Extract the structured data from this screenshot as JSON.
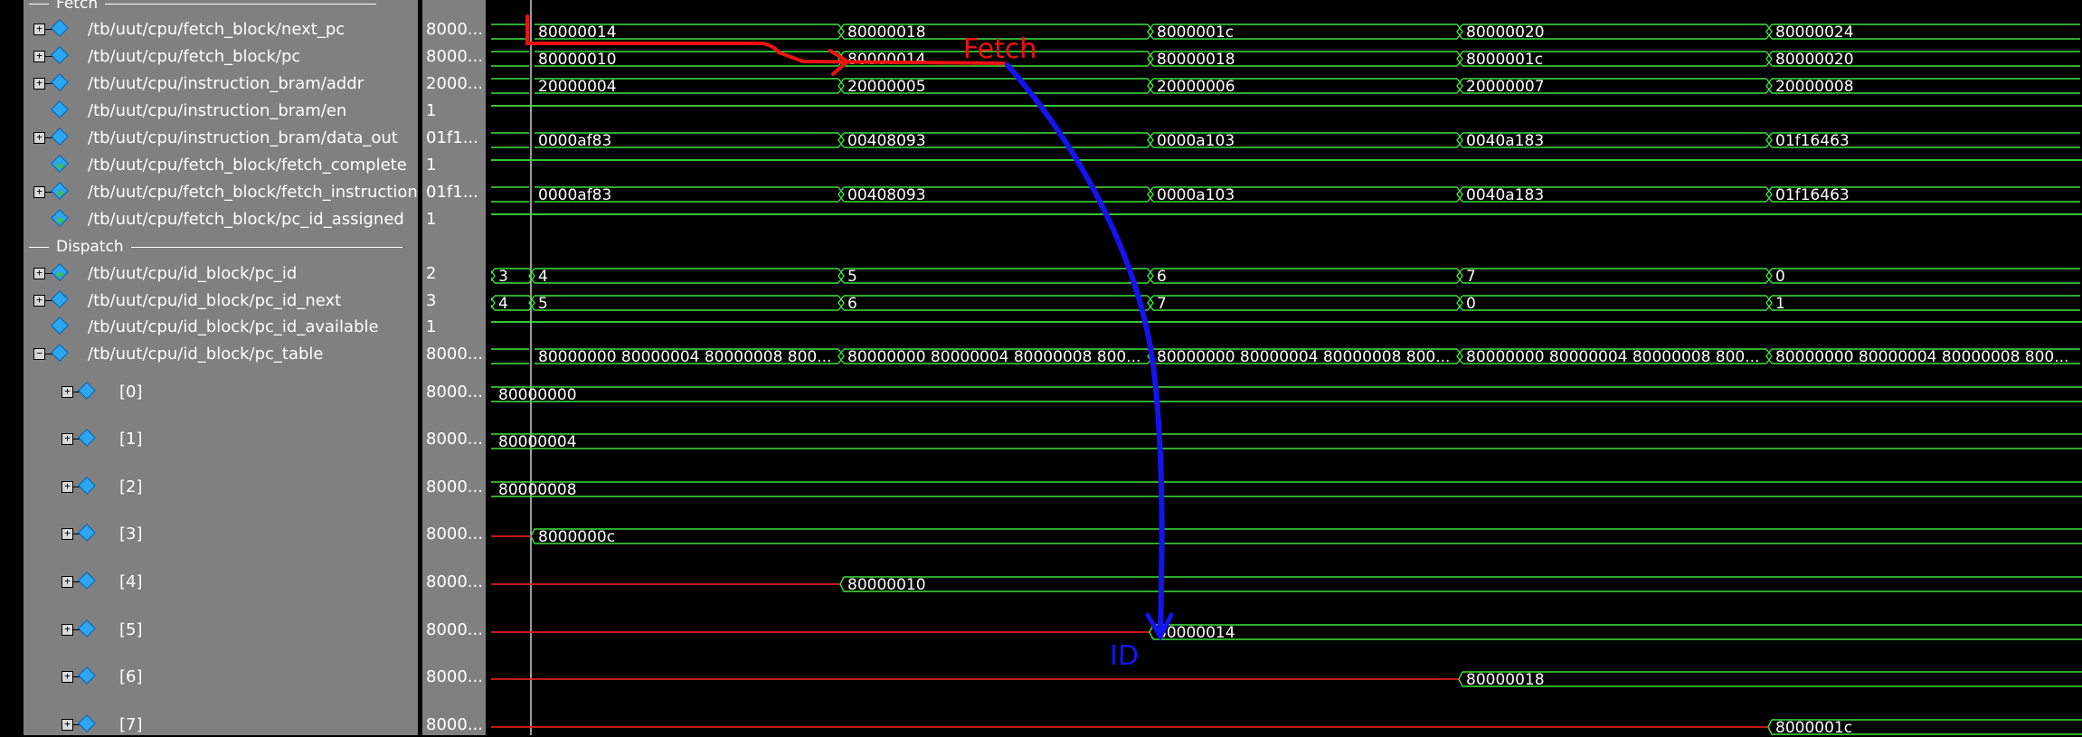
{
  "groups": {
    "fetch": "Fetch",
    "dispatch": "Dispatch"
  },
  "signals": [
    {
      "name": "/tb/uut/cpu/fetch_block/next_pc",
      "value": "8000...",
      "expand": "+",
      "icon": "signal-icon"
    },
    {
      "name": "/tb/uut/cpu/fetch_block/pc",
      "value": "8000...",
      "expand": "+",
      "icon": "signal-icon"
    },
    {
      "name": "/tb/uut/cpu/instruction_bram/addr",
      "value": "2000...",
      "expand": "+",
      "icon": "signal-icon"
    },
    {
      "name": "/tb/uut/cpu/instruction_bram/en",
      "value": "1",
      "expand": "",
      "icon": "signal-icon"
    },
    {
      "name": "/tb/uut/cpu/instruction_bram/data_out",
      "value": "01f1...",
      "expand": "+",
      "icon": "signal-icon"
    },
    {
      "name": "/tb/uut/cpu/fetch_block/fetch_complete",
      "value": "1",
      "expand": "",
      "icon": "signal-continuous-icon"
    },
    {
      "name": "/tb/uut/cpu/fetch_block/fetch_instruction",
      "value": "01f1...",
      "expand": "+",
      "icon": "signal-continuous-icon"
    },
    {
      "name": "/tb/uut/cpu/fetch_block/pc_id_assigned",
      "value": "1",
      "expand": "",
      "icon": "signal-continuous-icon"
    },
    {
      "name": "/tb/uut/cpu/id_block/pc_id",
      "value": "2",
      "expand": "+",
      "icon": "signal-continuous-icon"
    },
    {
      "name": "/tb/uut/cpu/id_block/pc_id_next",
      "value": "3",
      "expand": "+",
      "icon": "signal-icon"
    },
    {
      "name": "/tb/uut/cpu/id_block/pc_id_available",
      "value": "1",
      "expand": "",
      "icon": "signal-icon"
    },
    {
      "name": "/tb/uut/cpu/id_block/pc_table",
      "value": "8000...",
      "expand": "−",
      "icon": "signal-icon"
    },
    {
      "name": "[0]",
      "value": "8000...",
      "expand": "+",
      "icon": "signal-icon"
    },
    {
      "name": "[1]",
      "value": "8000...",
      "expand": "+",
      "icon": "signal-icon"
    },
    {
      "name": "[2]",
      "value": "8000...",
      "expand": "+",
      "icon": "signal-icon"
    },
    {
      "name": "[3]",
      "value": "8000...",
      "expand": "+",
      "icon": "signal-icon"
    },
    {
      "name": "[4]",
      "value": "8000...",
      "expand": "+",
      "icon": "signal-icon"
    },
    {
      "name": "[5]",
      "value": "8000...",
      "expand": "+",
      "icon": "signal-icon"
    },
    {
      "name": "[6]",
      "value": "8000...",
      "expand": "+",
      "icon": "signal-icon"
    },
    {
      "name": "[7]",
      "value": "8000...",
      "expand": "+",
      "icon": "signal-icon"
    }
  ],
  "waves": [
    {
      "kind": "bus",
      "segments": [
        "",
        "80000014",
        "80000018",
        "8000001c",
        "80000020",
        "80000024"
      ]
    },
    {
      "kind": "bus",
      "segments": [
        "",
        "80000010",
        "80000014",
        "80000018",
        "8000001c",
        "80000020"
      ]
    },
    {
      "kind": "bus",
      "segments": [
        "",
        "20000004",
        "20000005",
        "20000006",
        "20000007",
        "20000008"
      ]
    },
    {
      "kind": "bit"
    },
    {
      "kind": "bus",
      "segments": [
        "",
        "0000af83",
        "00408093",
        "0000a103",
        "0040a183",
        "01f16463"
      ]
    },
    {
      "kind": "bit"
    },
    {
      "kind": "bus",
      "segments": [
        "",
        "0000af83",
        "00408093",
        "0000a103",
        "0040a183",
        "01f16463"
      ]
    },
    {
      "kind": "bit"
    },
    {
      "kind": "bus",
      "segments": [
        "3",
        "4",
        "5",
        "6",
        "7",
        "0"
      ]
    },
    {
      "kind": "bus",
      "segments": [
        "4",
        "5",
        "6",
        "7",
        "0",
        "1"
      ]
    },
    {
      "kind": "bit"
    },
    {
      "kind": "bus",
      "segments": [
        "",
        "80000000 80000004 80000008 800...",
        "80000000 80000004 80000008 800...",
        "80000000 80000004 80000008 800...",
        "80000000 80000004 80000008 800...",
        "80000000 80000004 80000008 800..."
      ]
    },
    {
      "kind": "const",
      "value": "80000000"
    },
    {
      "kind": "const",
      "value": "80000004"
    },
    {
      "kind": "const",
      "value": "80000008"
    },
    {
      "kind": "undef",
      "value": "8000000c",
      "change": 1
    },
    {
      "kind": "undef",
      "value": "80000010",
      "change": 2
    },
    {
      "kind": "undef",
      "value": "80000014",
      "change": 3
    },
    {
      "kind": "undef",
      "value": "80000018",
      "change": 4
    },
    {
      "kind": "undef",
      "value": "8000001c",
      "change": 5
    }
  ],
  "annotations": {
    "fetch": "Fetch",
    "id": "ID"
  },
  "colors": {
    "wave": "#3ee23e",
    "undefined": "#e21b1b",
    "fetch_arrow": "#ee1111",
    "id_arrow": "#1414ee",
    "cursor": "#d0d0d0"
  }
}
